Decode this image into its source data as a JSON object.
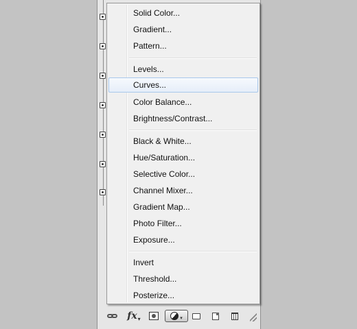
{
  "menu": {
    "groups": [
      [
        "Solid Color...",
        "Gradient...",
        "Pattern..."
      ],
      [
        "Levels...",
        "Curves...",
        "Color Balance...",
        "Brightness/Contrast..."
      ],
      [
        "Black & White...",
        "Hue/Saturation...",
        "Selective Color...",
        "Channel Mixer...",
        "Gradient Map...",
        "Photo Filter...",
        "Exposure..."
      ],
      [
        "Invert",
        "Threshold...",
        "Posterize..."
      ]
    ],
    "highlighted": "Curves..."
  },
  "toolbar": {
    "fx_label": "fx",
    "icons": [
      "link-layers-icon",
      "fx-icon",
      "layer-mask-icon",
      "adjustment-layer-icon",
      "group-folder-icon",
      "new-layer-icon",
      "trash-icon"
    ]
  },
  "colors": {
    "background": "#c3c3c3",
    "menu_bg": "#f0f0f0",
    "highlight_border": "#a8c8eb"
  }
}
